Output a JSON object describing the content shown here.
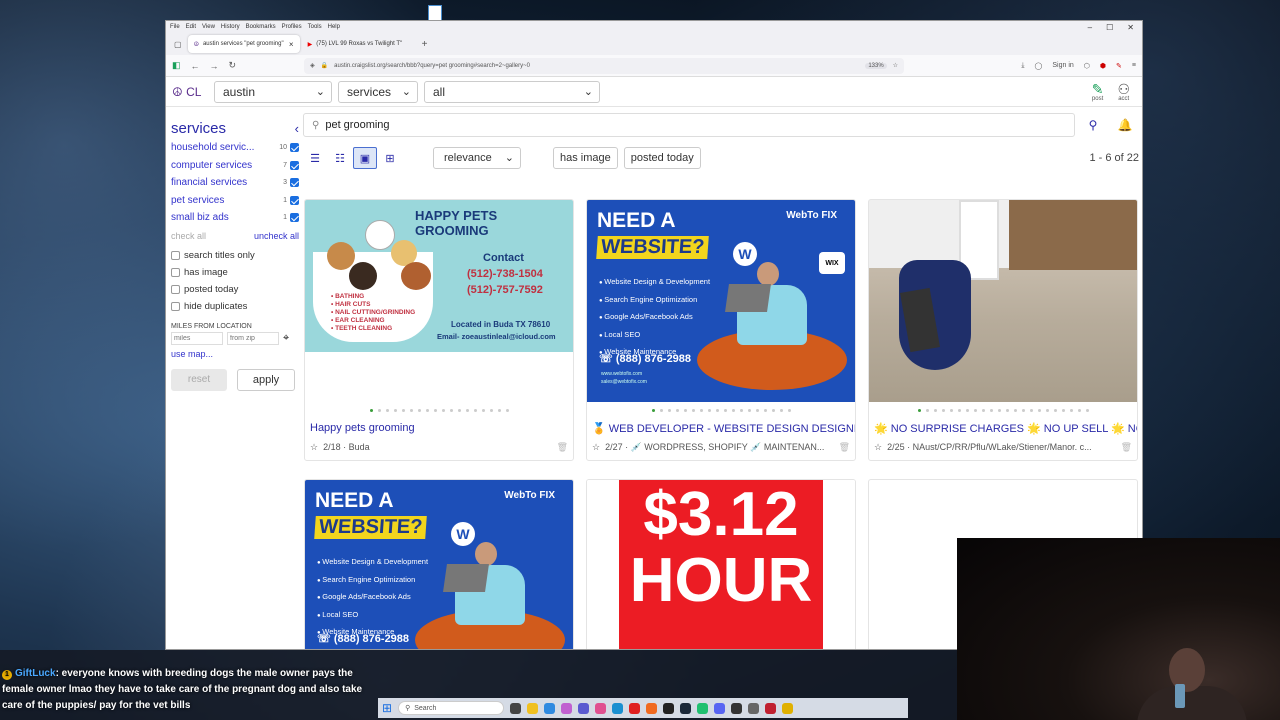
{
  "browser": {
    "menu": [
      "File",
      "Edit",
      "View",
      "History",
      "Bookmarks",
      "Profiles",
      "Tools",
      "Help"
    ],
    "tabs": [
      {
        "label": "austin services \"pet grooming\""
      },
      {
        "label": "(75) LVL 99 Roxas vs Twilight T\""
      }
    ],
    "url": "austin.craigslist.org/search/bbb?query=pet grooming#search=2~gallery~0",
    "zoom": "133%",
    "signin": "Sign in"
  },
  "header": {
    "logo": "CL",
    "city": "austin",
    "section": "services",
    "subsection": "all",
    "post": "post",
    "acct": "acct"
  },
  "sidebar": {
    "title": "services",
    "categories": [
      {
        "label": "household servic...",
        "count": "10"
      },
      {
        "label": "computer services",
        "count": "7"
      },
      {
        "label": "financial services",
        "count": "3"
      },
      {
        "label": "pet services",
        "count": "1"
      },
      {
        "label": "small biz ads",
        "count": "1"
      }
    ],
    "check_all": "check all",
    "uncheck_all": "uncheck all",
    "options": [
      "search titles only",
      "has image",
      "posted today",
      "hide duplicates"
    ],
    "miles_label": "MILES FROM LOCATION",
    "miles_placeholder": "miles",
    "zip_placeholder": "from zip",
    "use_map": "use map...",
    "reset": "reset",
    "apply": "apply"
  },
  "search": {
    "query": "pet grooming"
  },
  "toolbar": {
    "sort": "relevance",
    "filter1": "has image",
    "filter2": "posted today",
    "count": "1 - 6 of 22"
  },
  "listings": [
    {
      "title": "Happy pets grooming",
      "meta": "2/18 · Buda",
      "img": {
        "headline": "HAPPY PETS GROOMING",
        "contact": "Contact",
        "phone1": "(512)-738-1504",
        "phone2": "(512)-757-7592",
        "services": [
          "BATHING",
          "HAIR CUTS",
          "NAIL CUTTING/GRINDING",
          "EAR CLEANING",
          "TEETH CLEANING"
        ],
        "location": "Located in Buda TX 78610",
        "email": "Email- zoeaustinleal@icloud.com"
      }
    },
    {
      "title": "🏅 WEB DEVELOPER - WEBSITE DESIGN DESIGNER -...",
      "meta": "2/27 · 💉 WORDPRESS, SHOPIFY 💉 MAINTENAN...",
      "img": {
        "need": "NEED A",
        "website": "WEBSITE?",
        "brand": "WebTo FIX",
        "bullets": [
          "Website Design & Development",
          "Search Engine Optimization",
          "Google Ads/Facebook Ads",
          "Local SEO",
          "Website Maintenance"
        ],
        "phone": "(888) 876-2988",
        "web": "www.webtofix.com",
        "email": "sales@webtofix.com",
        "wix": "WIX"
      }
    },
    {
      "title": "🌟 NO SURPRISE CHARGES 🌟 NO UP SELL 🌟 NO R...",
      "meta": "2/25 · NAust/CP/RR/Pflu/WLake/Stiener/Manor. c..."
    },
    {
      "img": {
        "need": "NEED A",
        "website": "WEBSITE?",
        "brand": "WebTo FIX",
        "bullets": [
          "Website Design & Development",
          "Search Engine Optimization",
          "Google Ads/Facebook Ads",
          "Local SEO",
          "Website Maintenance"
        ],
        "phone": "(888) 876-2988"
      }
    },
    {
      "img": {
        "line1": "$3.12",
        "line2": "HOUR"
      }
    },
    {}
  ],
  "chat": {
    "badge": "1",
    "user": "GiftLuck",
    "message": ": everyone knows with breeding dogs the male owner pays the female owner lmao they have to take care of the pregnant dog and also take care of the puppies/ pay for the vet bills"
  },
  "taskbar": {
    "search": "Search"
  }
}
